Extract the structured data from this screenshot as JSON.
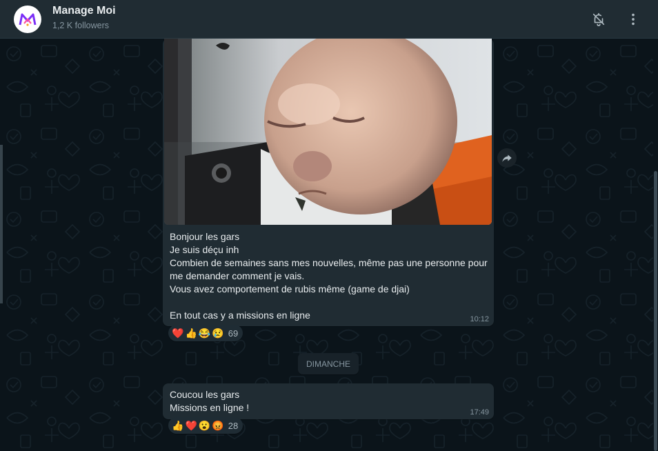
{
  "header": {
    "title": "Manage Moi",
    "subtitle": "1,2 K followers",
    "avatar_icon": "manage-moi-logo",
    "mute_icon": "bell-off-icon",
    "menu_icon": "more-vertical-icon"
  },
  "messages": [
    {
      "type": "media",
      "media_icon": "baby-photo",
      "text": "Bonjour les gars\nJe suis déçu inh\nCombien de semaines sans mes nouvelles, même pas une personne pour me demander comment je vais.\nVous avez comportement de rubis même (game de djai)\n\nEn tout cas y a missions en ligne",
      "time": "10:12",
      "reactions": [
        "❤️",
        "👍",
        "😂",
        "😢"
      ],
      "reaction_count": "69"
    },
    {
      "type": "text",
      "text": "Coucou les gars\nMissions en ligne !",
      "time": "17:49",
      "reactions": [
        "👍",
        "❤️",
        "😮",
        "😡"
      ],
      "reaction_count": "28"
    }
  ],
  "day_separator": "DIMANCHE",
  "colors": {
    "header_bg": "#202c33",
    "chat_bg": "#0b141a",
    "bubble_bg": "#202c33",
    "text": "#e9edef",
    "muted": "#8696a0",
    "brand": "#8e44ad"
  }
}
